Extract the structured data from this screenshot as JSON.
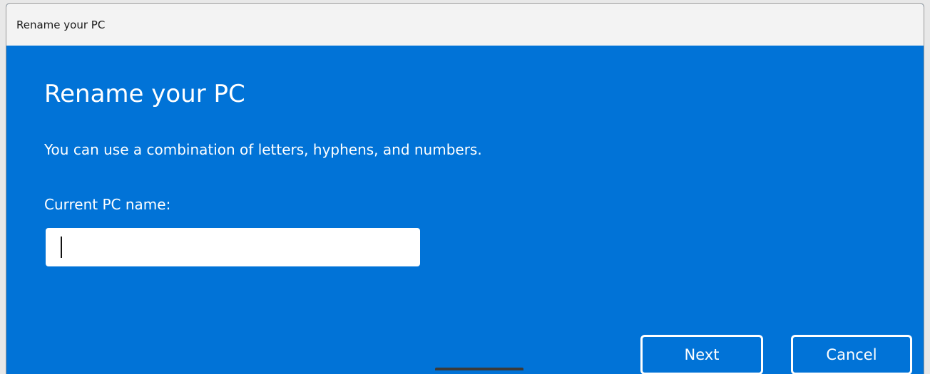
{
  "window": {
    "title": "Rename your PC"
  },
  "dialog": {
    "heading": "Rename your PC",
    "description": "You can use a combination of letters, hyphens, and numbers.",
    "current_name_label": "Current PC name:",
    "name_input_value": ""
  },
  "buttons": {
    "next": "Next",
    "cancel": "Cancel"
  },
  "colors": {
    "dialog_background": "#0173d7",
    "titlebar_background": "#f3f3f3",
    "text": "#ffffff"
  }
}
